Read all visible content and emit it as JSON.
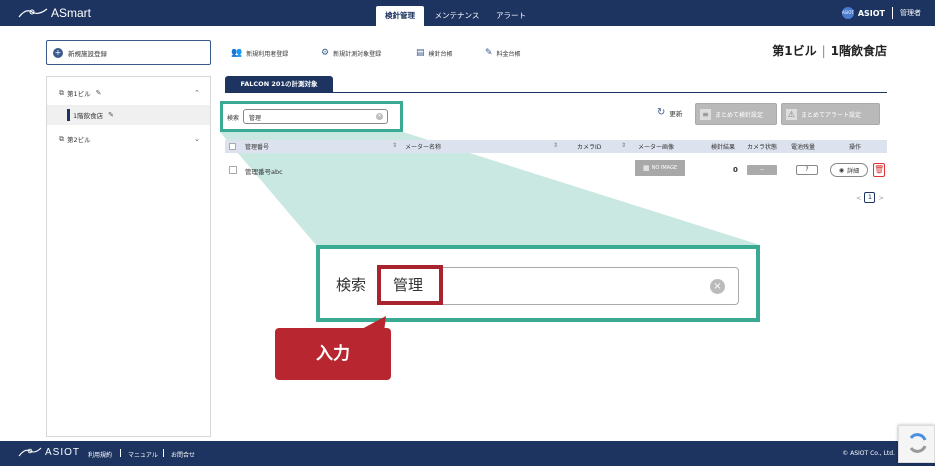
{
  "app": {
    "logo_text": "ASmart",
    "brand_right": "ASIOT",
    "brand_badge": "ASIOT",
    "user_label": "管理者",
    "accent": "#1d3461",
    "highlight": "#3aab92",
    "tag_color": "#b8272f"
  },
  "nav": {
    "tabs": [
      {
        "label": "検針管理",
        "active": true
      },
      {
        "label": "メンテナンス",
        "active": false
      },
      {
        "label": "アラート",
        "active": false
      }
    ]
  },
  "sidebar": {
    "new_facility": "新規施設登録",
    "items": [
      {
        "label": "第1ビル",
        "expanded": true
      },
      {
        "label": "1階飲食店",
        "selected": true
      },
      {
        "label": "第2ビル",
        "expanded": false
      }
    ]
  },
  "toolbar": {
    "items": [
      {
        "label": "新規利用者登録",
        "icon": "user-add-icon"
      },
      {
        "label": "新規計測対象登録",
        "icon": "meter-add-icon"
      },
      {
        "label": "検針台帳",
        "icon": "ledger-icon"
      },
      {
        "label": "料金台帳",
        "icon": "pen-icon"
      }
    ],
    "building": "第1ビル",
    "floor": "1階飲食店",
    "divider": "|"
  },
  "panel": {
    "tab_label": "FALCON 201の計測対象"
  },
  "search": {
    "label": "検索",
    "value": "管理"
  },
  "actions": {
    "refresh": "更新",
    "bulk_meter": "まとめて検針設定",
    "bulk_alert": "まとめてアラート設定"
  },
  "table": {
    "columns": [
      "管理番号",
      "メーター名称",
      "カメラID",
      "メーター画像",
      "検針結果",
      "カメラ状態",
      "電池残量",
      "操作"
    ],
    "rows": [
      {
        "id": "管理番号abc",
        "meter_name": "",
        "camera_id": "",
        "image": "NO IMAGE",
        "result": "0",
        "camera_state": "--",
        "battery": "?",
        "detail": "詳細"
      }
    ]
  },
  "pagination": {
    "current": "1",
    "prev": "<",
    "next": ">"
  },
  "zoom": {
    "label": "検索",
    "value": "管理",
    "clear": "×"
  },
  "callout": {
    "text": "入力"
  },
  "footer": {
    "logo": "ASIOT",
    "links": [
      "利用規約",
      "マニュアル",
      "お問合せ"
    ],
    "copyright": "© ASIOT Co., Ltd."
  }
}
